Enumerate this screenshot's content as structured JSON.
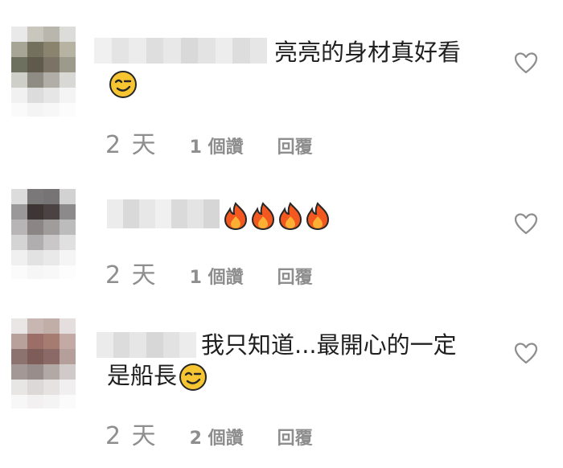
{
  "comments": [
    {
      "text": "亮亮的身材真好看",
      "emoji": "winking-face-emoji",
      "time": "2 天",
      "likes": "1 個讚",
      "reply": "回覆",
      "heart_icon": "heart-outline-icon"
    },
    {
      "text": "",
      "emoji": "fire-emoji",
      "emoji_count": 4,
      "time": "2 天",
      "likes": "1 個讚",
      "reply": "回覆",
      "heart_icon": "heart-outline-icon"
    },
    {
      "text": "我只知道...最開心的一定",
      "text_line2": "是船長",
      "emoji": "winking-face-emoji",
      "time": "2 天",
      "likes": "2 個讚",
      "reply": "回覆",
      "heart_icon": "heart-outline-icon"
    }
  ],
  "colors": {
    "text": "#1f1f1f",
    "meta": "#8e8e8e",
    "heart_stroke": "#8e8e8e",
    "emoji_face": "#f7c531",
    "fire_outer": "#f2581f",
    "fire_inner": "#fbb034"
  }
}
